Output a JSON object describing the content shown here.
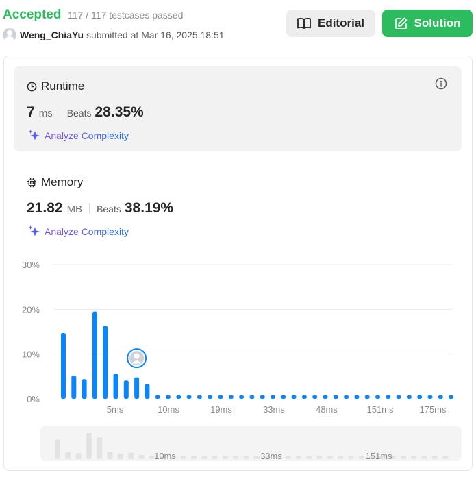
{
  "header": {
    "status": "Accepted",
    "testcases": "117 / 117 testcases passed",
    "username": "Weng_ChiaYu",
    "submitted_text": "submitted at Mar 16, 2025 18:51",
    "editorial_label": "Editorial",
    "solution_label": "Solution"
  },
  "runtime": {
    "title": "Runtime",
    "value": "7",
    "unit": "ms",
    "beats_label": "Beats",
    "beats_pct": "28.35%",
    "analyze_label": "Analyze Complexity"
  },
  "memory": {
    "title": "Memory",
    "value": "21.82",
    "unit": "MB",
    "beats_label": "Beats",
    "beats_pct": "38.19%",
    "analyze_label": "Analyze Complexity"
  },
  "colors": {
    "accepted": "#2cbb5d",
    "bar": "#0a84ff",
    "minimap_bar": "#e3e3e3"
  },
  "chart_data": {
    "type": "bar",
    "ylim": [
      0,
      30
    ],
    "y_ticks": [
      "30%",
      "20%",
      "10%",
      "0%"
    ],
    "x_tick_labels": [
      "5ms",
      "10ms",
      "19ms",
      "33ms",
      "48ms",
      "151ms",
      "175ms"
    ],
    "values": [
      14.7,
      5.2,
      4.4,
      19.5,
      16.3,
      5.6,
      4.1,
      4.8,
      3.3,
      0.8,
      0.8,
      0.8,
      0.8,
      0.8,
      0.8,
      0.8,
      0.8,
      0.8,
      0.8,
      0.8,
      0.8,
      0.8,
      0.8,
      0.8,
      0.8,
      0.8,
      0.8,
      0.8,
      0.8,
      0.8,
      0.8,
      0.8,
      0.8,
      0.8,
      0.8,
      0.8,
      0.8,
      0.8
    ],
    "user_bar_index": 7,
    "minimap_tick_labels": [
      "10ms",
      "33ms",
      "151ms"
    ]
  }
}
